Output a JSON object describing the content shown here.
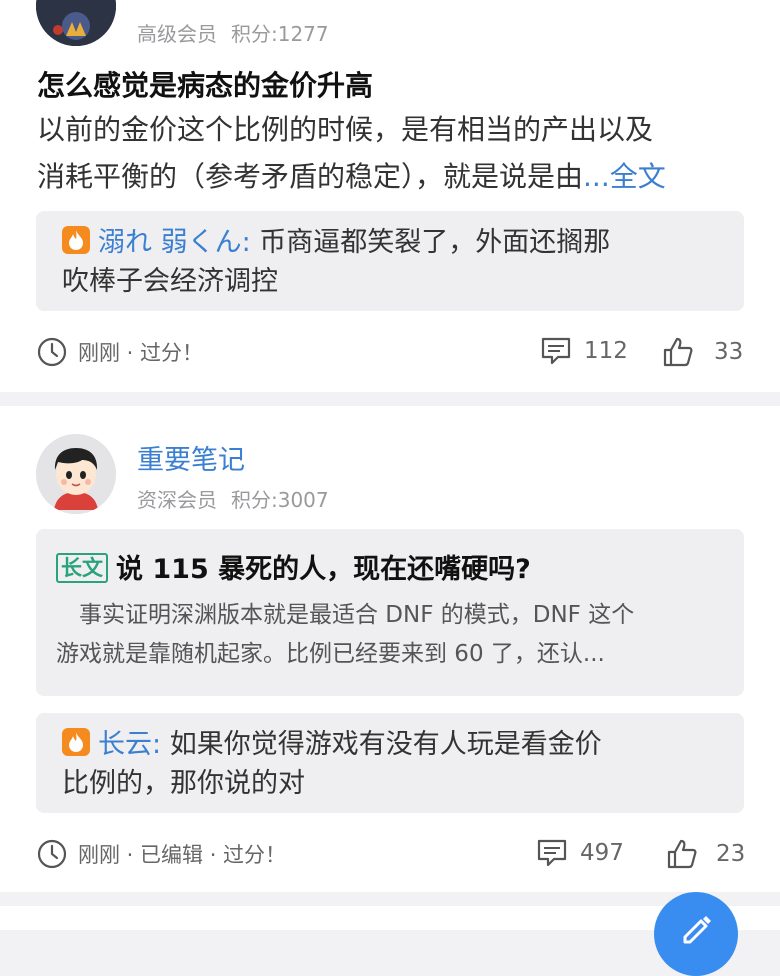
{
  "posts": [
    {
      "member_level": "高级会员",
      "points": "积分:1277",
      "title": "怎么感觉是病态的金价升高",
      "body_line1": "以前的金价这个比例的时候，是有相当的产出以及",
      "body_line2": "消耗平衡的（参考矛盾的稳定），就是说是由",
      "full_text_link": "...全文",
      "top_comment": {
        "user": "溺れ 弱くん:",
        "text_line1": " 币商逼都笑裂了，外面还搁那",
        "text_line2": "吹棒子会经济调控"
      },
      "time_info": "刚刚 · 过分！",
      "comment_count": "112",
      "like_count": "33"
    },
    {
      "username": "重要笔记",
      "member_level": "资深会员",
      "points": "积分:3007",
      "article": {
        "tag": "长文",
        "title": "说 115 暴死的人，现在还嘴硬吗?",
        "excerpt_line1": "　事实证明深渊版本就是最适合 DNF 的模式，DNF 这个",
        "excerpt_line2": "游戏就是靠随机起家。比例已经要来到 60 了，还认..."
      },
      "top_comment": {
        "user": "长云:",
        "text_line1": " 如果你觉得游戏有没有人玩是看金价",
        "text_line2": "比例的，那你说的对"
      },
      "time_info": "刚刚 · 已编辑 · 过分！",
      "comment_count": "497",
      "like_count": "23"
    }
  ],
  "icons": {
    "hot_badge": "fire-icon",
    "clock": "clock-icon",
    "comment": "comment-icon",
    "like": "thumbs-up-icon",
    "compose": "edit-icon"
  },
  "colors": {
    "link_blue": "#3b7fd1",
    "hot_orange": "#f58a1f",
    "tag_green": "#2aa37a",
    "fab_blue": "#3a8df0"
  }
}
